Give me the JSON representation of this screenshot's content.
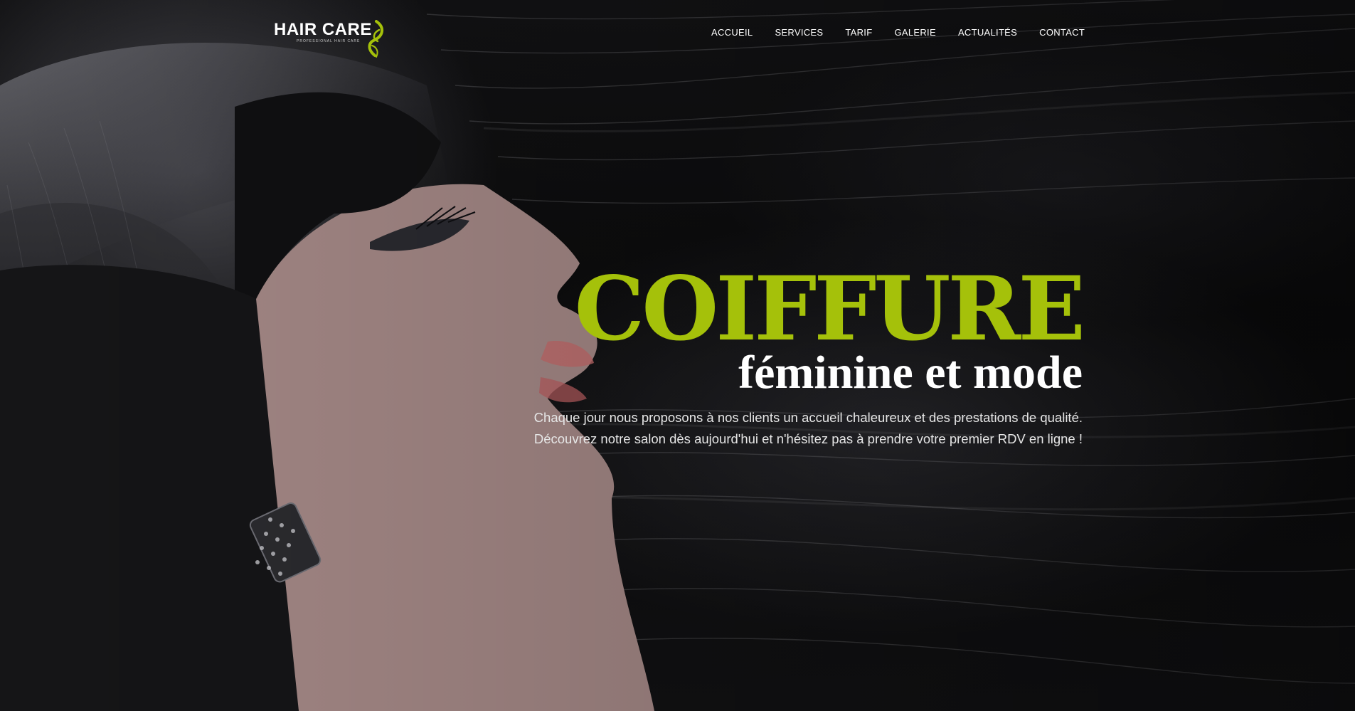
{
  "brand": {
    "name": "HAIR CARE",
    "tagline": "PROFESSIONAL HAIR CARE",
    "accent_color": "#a5c10a",
    "logo_icon": "leaf-swirl-icon"
  },
  "nav": {
    "items": [
      {
        "label": "ACCUEIL"
      },
      {
        "label": "SERVICES"
      },
      {
        "label": "TARIF"
      },
      {
        "label": "GALERIE"
      },
      {
        "label": "ACTUALITÉS"
      },
      {
        "label": "CONTACT"
      }
    ]
  },
  "hero": {
    "headline": "COIFFURE",
    "subheadline": "féminine et mode",
    "paragraph_line_1": "Chaque jour nous proposons à nos clients un accueil chaleureux et des prestations de qualité.",
    "paragraph_line_2": "Découvrez notre salon dès aujourd'hui et n'hésitez pas à prendre votre premier RDV en ligne !"
  }
}
